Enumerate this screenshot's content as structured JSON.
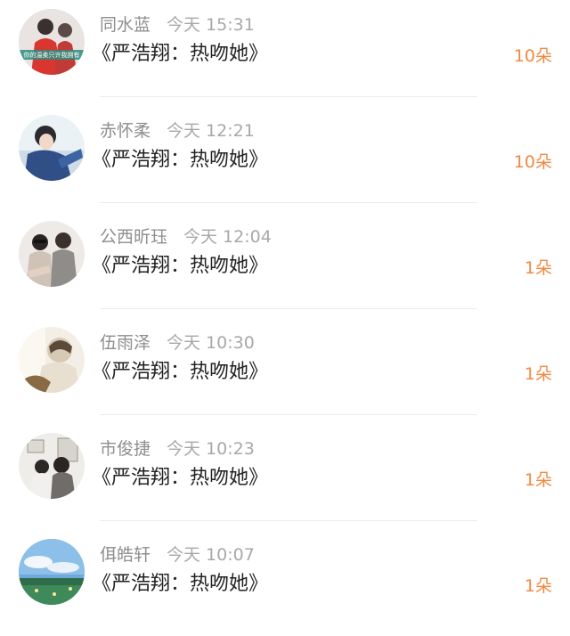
{
  "rows": [
    {
      "name": "同水蓝",
      "time": "今天 15:31",
      "title": "《严浩翔：热吻她》",
      "count": "10朵",
      "avatar": {
        "icon": "person-red-avatar-icon",
        "caption": "你的温柔只许我拥有"
      }
    },
    {
      "name": "赤怀柔",
      "time": "今天 12:21",
      "title": "《严浩翔：热吻她》",
      "count": "10朵",
      "avatar": {
        "icon": "person-blue-jacket-avatar-icon"
      }
    },
    {
      "name": "公西昕珏",
      "time": "今天 12:04",
      "title": "《严浩翔：热吻她》",
      "count": "1朵",
      "avatar": {
        "icon": "two-people-avatar-icon"
      }
    },
    {
      "name": "伍雨泽",
      "time": "今天 10:30",
      "title": "《严浩翔：热吻她》",
      "count": "1朵",
      "avatar": {
        "icon": "person-back-avatar-icon"
      }
    },
    {
      "name": "市俊捷",
      "time": "今天 10:23",
      "title": "《严浩翔：热吻她》",
      "count": "1朵",
      "avatar": {
        "icon": "couple-room-avatar-icon"
      }
    },
    {
      "name": "佴皓轩",
      "time": "今天 10:07",
      "title": "《严浩翔：热吻她》",
      "count": "1朵",
      "avatar": {
        "icon": "landscape-sky-avatar-icon"
      }
    }
  ]
}
